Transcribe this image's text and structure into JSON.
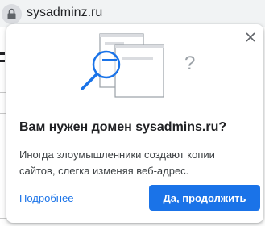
{
  "address_bar": {
    "url": "sysadminz.ru",
    "lock_icon": "lock-icon"
  },
  "dialog": {
    "title": "Вам нужен домен sysadmins.ru?",
    "body": "Иногда злоумышленники создают копии сайтов, слегка изменяя веб-адрес.",
    "learn_more_link": "Подробнее",
    "continue_button": "Да, продолжить",
    "close_icon": "close-icon",
    "illustration_question_mark": "?"
  },
  "colors": {
    "accent": "#1a73e8",
    "text": "#202124",
    "secondary_text": "#3c4043",
    "illustration_gray": "#9aa0a6"
  }
}
